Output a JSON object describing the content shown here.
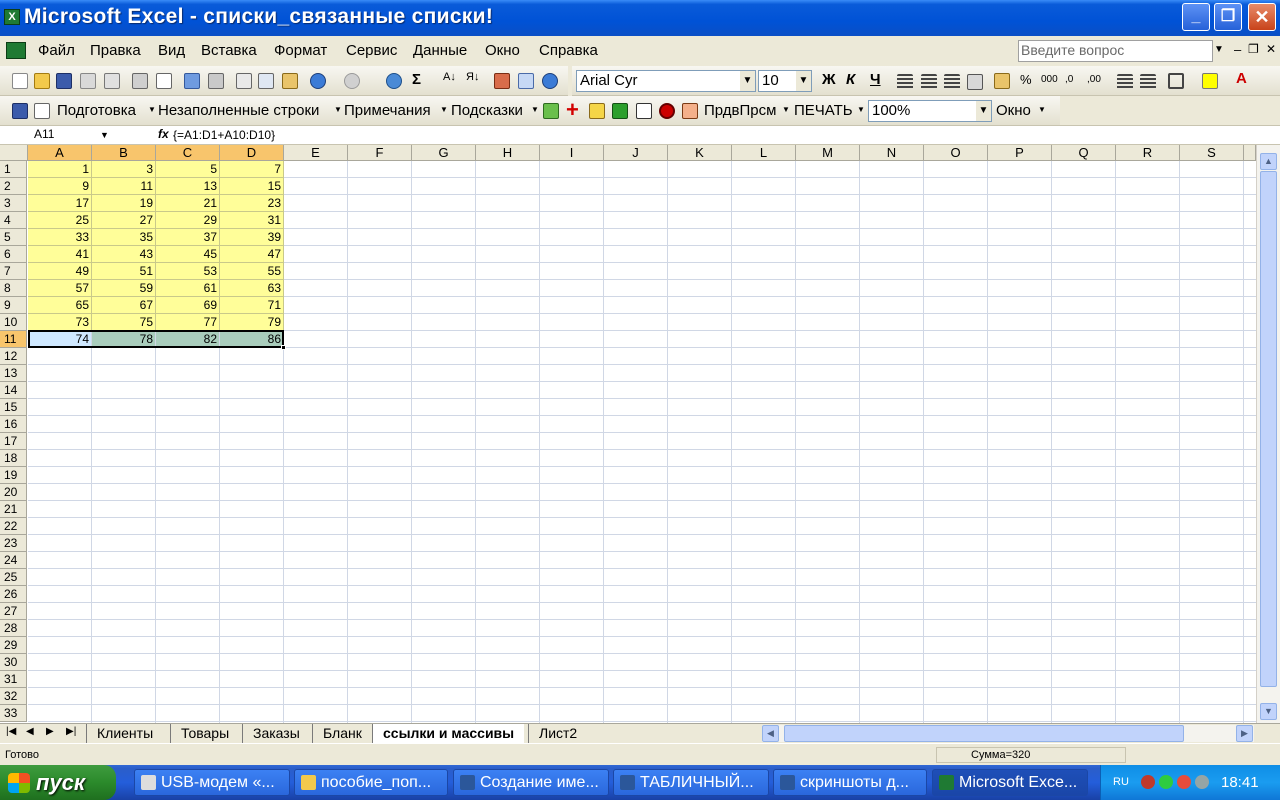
{
  "window": {
    "title": "Microsoft Excel - списки_связанные списки!",
    "app_icon_letter": "X"
  },
  "menu": {
    "items": [
      "Файл",
      "Правка",
      "Вид",
      "Вставка",
      "Формат",
      "Сервис",
      "Данные",
      "Окно",
      "Справка"
    ],
    "ask_placeholder": "Введите вопрос"
  },
  "format_toolbar": {
    "font_name": "Arial Cyr",
    "font_size": "10",
    "bold": "Ж",
    "italic": "К",
    "underline": "Ч"
  },
  "custom_toolbar": {
    "items": [
      "Подготовка",
      "Незаполненные строки",
      "Примечания",
      "Подсказки"
    ],
    "prdv": "ПрдвПрсм",
    "print": "ПЕЧАТЬ",
    "zoom": "100%",
    "window": "Окно"
  },
  "formula_bar": {
    "name_box": "A11",
    "fx": "fx",
    "formula": "{=A1:D1+A10:D10}"
  },
  "sheet": {
    "columns": [
      "A",
      "B",
      "C",
      "D",
      "E",
      "F",
      "G",
      "H",
      "I",
      "J",
      "K",
      "L",
      "M",
      "N",
      "O",
      "P",
      "Q",
      "R",
      "S"
    ],
    "rows": [
      "1",
      "2",
      "3",
      "4",
      "5",
      "6",
      "7",
      "8",
      "9",
      "10",
      "11",
      "12",
      "13",
      "14",
      "15",
      "16",
      "17",
      "18",
      "19",
      "20",
      "21",
      "22",
      "23",
      "24",
      "25",
      "26",
      "27",
      "28",
      "29",
      "30",
      "31",
      "32",
      "33"
    ],
    "data": [
      [
        1,
        3,
        5,
        7
      ],
      [
        9,
        11,
        13,
        15
      ],
      [
        17,
        19,
        21,
        23
      ],
      [
        25,
        27,
        29,
        31
      ],
      [
        33,
        35,
        37,
        39
      ],
      [
        41,
        43,
        45,
        47
      ],
      [
        49,
        51,
        53,
        55
      ],
      [
        57,
        59,
        61,
        63
      ],
      [
        65,
        67,
        69,
        71
      ],
      [
        73,
        75,
        77,
        79
      ],
      [
        74,
        78,
        82,
        86
      ]
    ],
    "selected_row": "11",
    "selected_columns": [
      "A",
      "B",
      "C",
      "D"
    ]
  },
  "tabs": [
    "Клиенты",
    "Товары",
    "Заказы",
    "Бланк",
    "ссылки и массивы",
    "Лист2"
  ],
  "active_tab": "ссылки и массивы",
  "status": {
    "ready": "Готово",
    "sum": "Сумма=320"
  },
  "taskbar": {
    "start": "пуск",
    "tasks": [
      "USB-модем «...",
      "пособие_поп...",
      "Создание име...",
      "ТАБЛИЧНЫЙ...",
      "скриншоты д...",
      "Microsoft Exce..."
    ],
    "lang": "RU",
    "clock": "18:41"
  },
  "colors": {
    "selection_header": "#f8c56c",
    "data_fill": "#fffe99",
    "result_fill": "#a9cdbc",
    "titlebar": "#0052d6"
  }
}
